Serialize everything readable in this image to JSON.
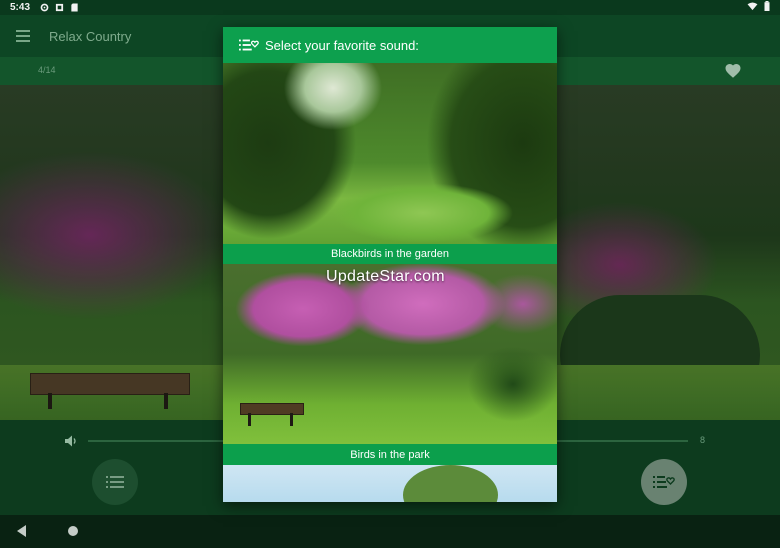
{
  "statusbar": {
    "time": "5:43",
    "icons": [
      "gear-icon",
      "notification-icon",
      "sd-card-icon"
    ],
    "right_icons": [
      "wifi-icon",
      "battery-icon"
    ]
  },
  "app": {
    "title": "Relax Country"
  },
  "subbar": {
    "counter": "4/14"
  },
  "controls": {
    "volume_value": "8"
  },
  "dialog": {
    "title": "Select your favorite sound:",
    "items": [
      {
        "caption": "Blackbirds in the garden"
      },
      {
        "caption": "Birds in the park"
      },
      {
        "caption": ""
      }
    ]
  },
  "watermark": "UpdateStar.com",
  "colors": {
    "accent": "#0da04e",
    "appbar": "#0e4a26",
    "statusbar": "#0b3d1f"
  }
}
